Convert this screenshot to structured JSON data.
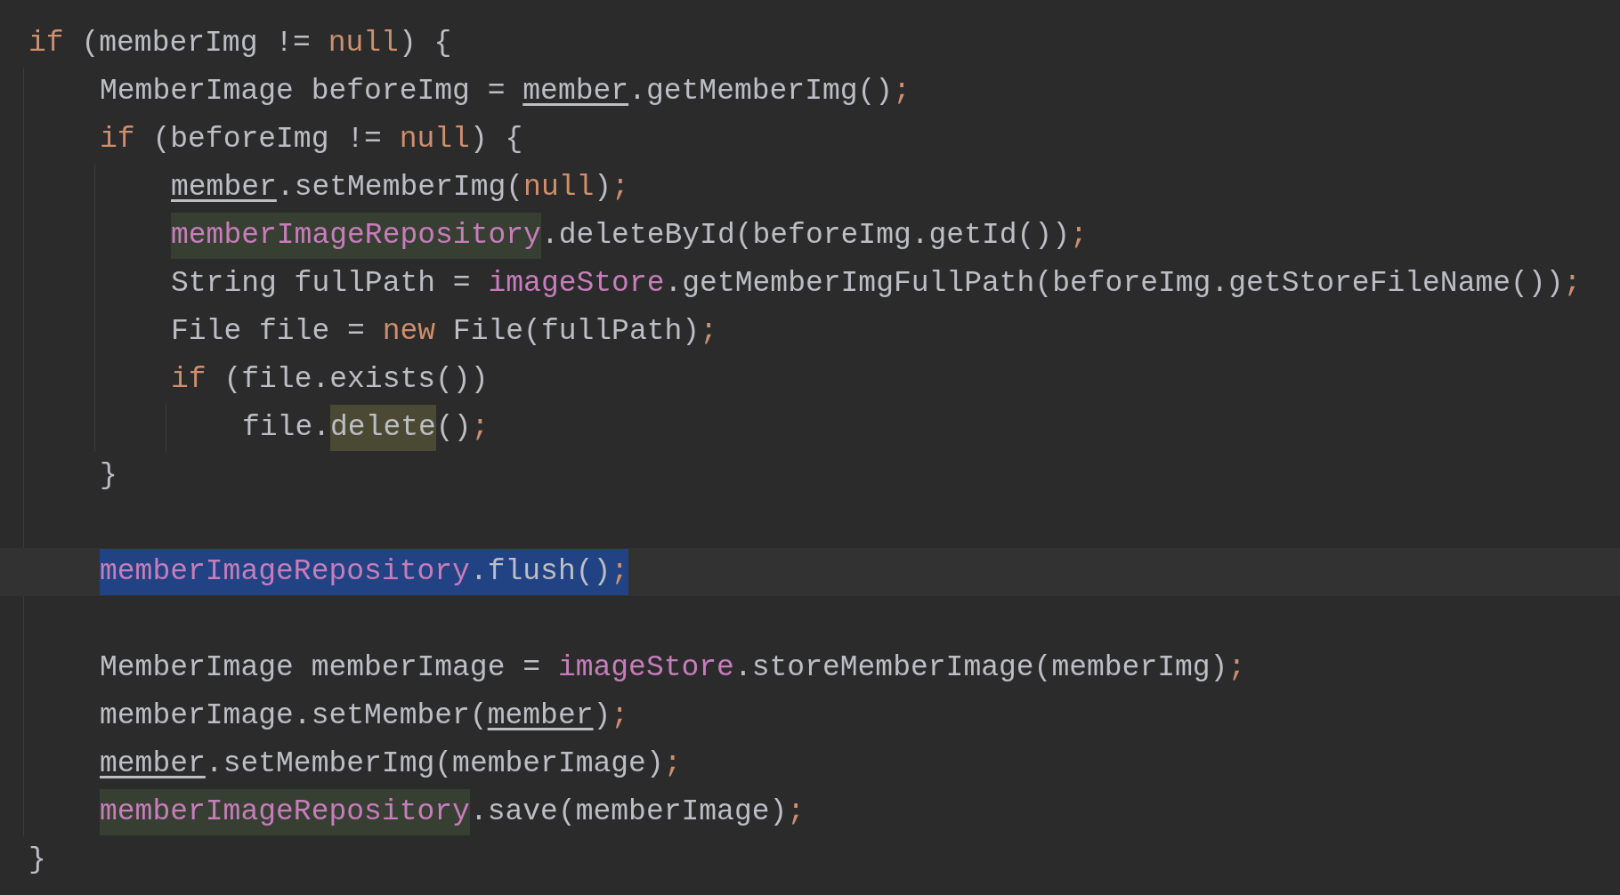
{
  "code": [
    {
      "kind": "code",
      "tokens": [
        {
          "text": "if",
          "kind": "keyword"
        },
        {
          "text": " (memberImg != ",
          "kind": "plain"
        },
        {
          "text": "null",
          "kind": "keyword"
        },
        {
          "text": ") {",
          "kind": "plain"
        }
      ],
      "children": [
        {
          "kind": "code",
          "tokens": [
            {
              "text": "MemberImage beforeImg = ",
              "kind": "plain"
            },
            {
              "text": "member",
              "kind": "variable"
            },
            {
              "text": ".getMemberImg()",
              "kind": "plain"
            },
            {
              "text": ";",
              "kind": "punct"
            }
          ]
        },
        {
          "kind": "code",
          "tokens": [
            {
              "text": "if",
              "kind": "keyword"
            },
            {
              "text": " (beforeImg != ",
              "kind": "plain"
            },
            {
              "text": "null",
              "kind": "keyword"
            },
            {
              "text": ") {",
              "kind": "plain"
            }
          ],
          "children": [
            {
              "kind": "code",
              "tokens": [
                {
                  "text": "member",
                  "kind": "variable"
                },
                {
                  "text": ".setMemberImg(",
                  "kind": "plain"
                },
                {
                  "text": "null",
                  "kind": "keyword"
                },
                {
                  "text": ")",
                  "kind": "plain"
                },
                {
                  "text": ";",
                  "kind": "punct"
                }
              ]
            },
            {
              "kind": "code",
              "tokens": [
                {
                  "text": "memberImageRepository",
                  "kind": "field",
                  "usage_highlighted": true
                },
                {
                  "text": ".deleteById(beforeImg.getId())",
                  "kind": "plain"
                },
                {
                  "text": ";",
                  "kind": "punct"
                }
              ]
            },
            {
              "kind": "code",
              "tokens": [
                {
                  "text": "String fullPath = ",
                  "kind": "plain"
                },
                {
                  "text": "imageStore",
                  "kind": "field"
                },
                {
                  "text": ".getMemberImgFullPath(beforeImg.getStoreFileName())",
                  "kind": "plain"
                },
                {
                  "text": ";",
                  "kind": "punct"
                }
              ]
            },
            {
              "kind": "code",
              "tokens": [
                {
                  "text": "File file = ",
                  "kind": "plain"
                },
                {
                  "text": "new",
                  "kind": "keyword"
                },
                {
                  "text": " File(fullPath)",
                  "kind": "plain"
                },
                {
                  "text": ";",
                  "kind": "punct"
                }
              ]
            },
            {
              "kind": "code",
              "tokens": [
                {
                  "text": "if",
                  "kind": "keyword"
                },
                {
                  "text": " (file.exists())",
                  "kind": "plain"
                }
              ],
              "children": [
                {
                  "kind": "code",
                  "tokens": [
                    {
                      "text": "file.",
                      "kind": "plain"
                    },
                    {
                      "text": "delete",
                      "kind": "plain",
                      "write_highlighted": true
                    },
                    {
                      "text": "()",
                      "kind": "plain"
                    },
                    {
                      "text": ";",
                      "kind": "punct"
                    }
                  ]
                }
              ]
            }
          ]
        },
        {
          "kind": "code",
          "tokens": [
            {
              "text": "}",
              "kind": "plain"
            }
          ]
        },
        {
          "kind": "blank"
        },
        {
          "kind": "code",
          "current": true,
          "tokens": [
            {
              "text": "memberImageRepository",
              "kind": "field",
              "selected": true
            },
            {
              "text": ".flush()",
              "kind": "plain",
              "selected": true
            },
            {
              "text": ";",
              "kind": "punct",
              "selected": true
            }
          ]
        },
        {
          "kind": "blank"
        },
        {
          "kind": "code",
          "tokens": [
            {
              "text": "MemberImage memberImage = ",
              "kind": "plain"
            },
            {
              "text": "imageStore",
              "kind": "field"
            },
            {
              "text": ".storeMemberImage(memberImg)",
              "kind": "plain"
            },
            {
              "text": ";",
              "kind": "punct"
            }
          ]
        },
        {
          "kind": "code",
          "tokens": [
            {
              "text": "memberImage.setMember(",
              "kind": "plain"
            },
            {
              "text": "member",
              "kind": "variable"
            },
            {
              "text": ")",
              "kind": "plain"
            },
            {
              "text": ";",
              "kind": "punct"
            }
          ]
        },
        {
          "kind": "code",
          "tokens": [
            {
              "text": "member",
              "kind": "variable"
            },
            {
              "text": ".setMemberImg(memberImage)",
              "kind": "plain"
            },
            {
              "text": ";",
              "kind": "punct"
            }
          ]
        },
        {
          "kind": "code",
          "tokens": [
            {
              "text": "memberImageRepository",
              "kind": "field",
              "usage_highlighted": true
            },
            {
              "text": ".save(memberImage)",
              "kind": "plain"
            },
            {
              "text": ";",
              "kind": "punct"
            }
          ]
        }
      ]
    },
    {
      "kind": "code",
      "tokens": [
        {
          "text": "}",
          "kind": "plain"
        }
      ]
    }
  ]
}
